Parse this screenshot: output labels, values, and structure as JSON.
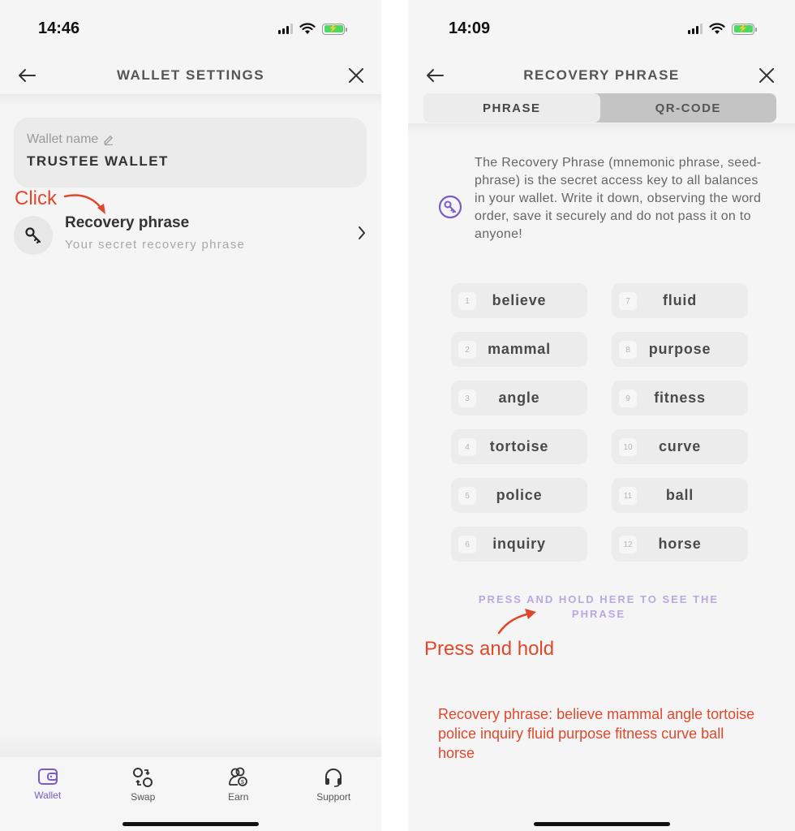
{
  "left_screen": {
    "status": {
      "time": "14:46"
    },
    "nav": {
      "title": "WALLET SETTINGS"
    },
    "wallet_card": {
      "label": "Wallet name",
      "value": "TRUSTEE WALLET"
    },
    "annotation": "Click",
    "recovery_row": {
      "title": "Recovery phrase",
      "subtitle": "Your secret recovery phrase"
    },
    "tabs": [
      {
        "label": "Wallet",
        "icon": "wallet-icon",
        "active": true
      },
      {
        "label": "Swap",
        "icon": "swap-icon",
        "active": false
      },
      {
        "label": "Earn",
        "icon": "earn-icon",
        "active": false
      },
      {
        "label": "Support",
        "icon": "headset-icon",
        "active": false
      }
    ]
  },
  "right_screen": {
    "status": {
      "time": "14:09"
    },
    "nav": {
      "title": "RECOVERY PHRASE"
    },
    "segment": {
      "options": [
        "PHRASE",
        "QR-CODE"
      ],
      "selected": "PHRASE"
    },
    "info_text": "The Recovery Phrase (mnemonic phrase, seed-phrase) is the secret access key to all balances in your wallet. Write it down, observing the word order, save it securely and do not pass it on to anyone!",
    "words": [
      {
        "index": "1",
        "word": "believe"
      },
      {
        "index": "2",
        "word": "mammal"
      },
      {
        "index": "3",
        "word": "angle"
      },
      {
        "index": "4",
        "word": "tortoise"
      },
      {
        "index": "5",
        "word": "police"
      },
      {
        "index": "6",
        "word": "inquiry"
      },
      {
        "index": "7",
        "word": "fluid"
      },
      {
        "index": "8",
        "word": "purpose"
      },
      {
        "index": "9",
        "word": "fitness"
      },
      {
        "index": "10",
        "word": "curve"
      },
      {
        "index": "11",
        "word": "ball"
      },
      {
        "index": "12",
        "word": "horse"
      }
    ],
    "hold_hint": "PRESS AND HOLD HERE TO SEE THE PHRASE",
    "annotation": "Press and hold",
    "phrase_note": "Recovery phrase: believe mammal angle tortoise police inquiry fluid purpose fitness curve ball horse"
  },
  "colors": {
    "accent": "#7b5cc4",
    "annotation": "#e0482c",
    "hint": "#b9a9e0",
    "battery": "#4cd964"
  }
}
